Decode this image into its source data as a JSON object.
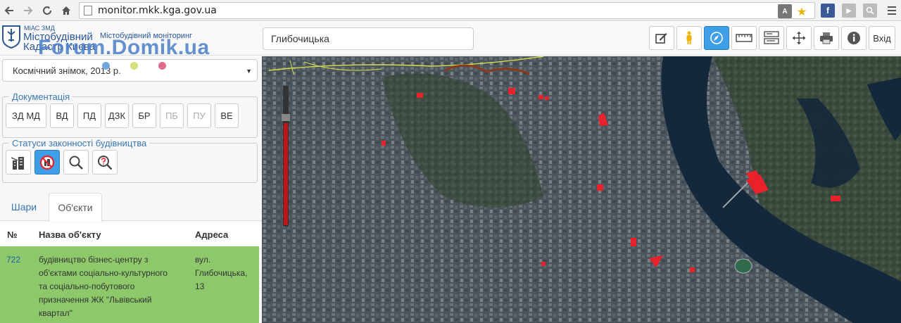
{
  "browser": {
    "url": "monitor.mkk.kga.gov.ua",
    "nav_icons": [
      "back-icon",
      "forward-icon",
      "reload-icon",
      "home-icon"
    ]
  },
  "header": {
    "logo_small": "МІАС ЗМД",
    "logo_line1": "Містобудівний",
    "logo_line2": "Кадастр Києва",
    "subtitle": "Містобудівний моніторинг",
    "watermark": "Forum.Domik.ua",
    "search_value": "Глибочицька",
    "logout_label": "Вхід",
    "tools": [
      "edit-icon",
      "pegman-icon",
      "compass-icon",
      "ruler-icon",
      "layers-icon",
      "move-icon",
      "print-icon",
      "info-icon"
    ],
    "accent_color": "#3e9ee8"
  },
  "sidebar": {
    "layer_select": "Космічний знімок, 2013 р.",
    "dots": [
      "#6fa8dc",
      "#d4e07a",
      "#e06b8b"
    ],
    "documentation": {
      "legend": "Документація",
      "buttons": [
        "ЗД МД",
        "ВД",
        "ПД",
        "ДЗК",
        "БР",
        "ПБ",
        "ПУ",
        "ВЕ"
      ]
    },
    "statuses": {
      "legend": "Статуси законності будівництва"
    },
    "tabs": {
      "layers": "Шари",
      "objects": "Об'єкти"
    },
    "table": {
      "headers": {
        "num": "№",
        "name": "Назва об'єкту",
        "address": "Адреса"
      },
      "rows": [
        {
          "num": "722",
          "name_lines": [
            "будівництво бізнес-центру з",
            "об'єктами соціально-культурного",
            "та соціально-побутового",
            "призначення ЖК \"Львівський",
            "квартал\""
          ],
          "address_lines": [
            "вул.",
            "Глибочицька,",
            "13"
          ]
        }
      ]
    }
  },
  "map": {
    "highlight_color": "#e8212a",
    "river_color": "#14283b"
  }
}
